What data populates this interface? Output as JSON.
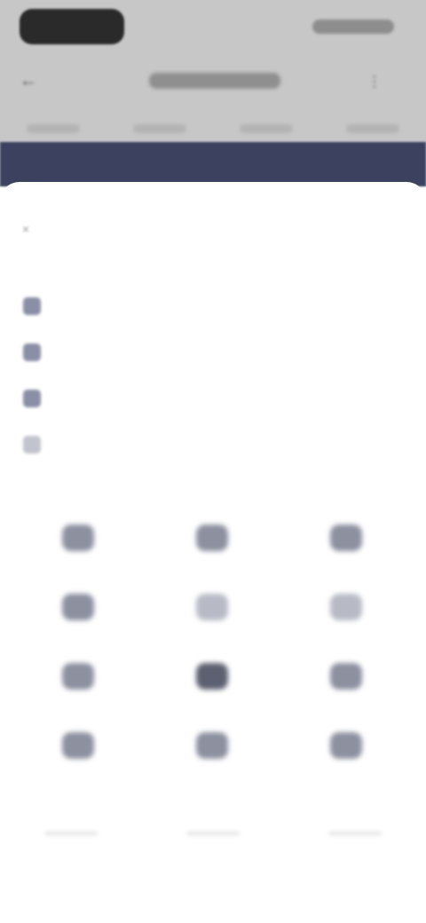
{
  "background": {
    "status_time": "",
    "status_right": "",
    "back_icon": "back-arrow-icon",
    "title": "",
    "action_icon": "more-icon",
    "tabs": [
      "",
      "",
      "",
      ""
    ],
    "nav_band_color": "#3c4160"
  },
  "sheet": {
    "close_icon": "×",
    "title": "",
    "section1_title": "",
    "menu": [
      {
        "label": "",
        "icon": "settings-icon"
      },
      {
        "label": "",
        "icon": "document-icon"
      },
      {
        "label": "",
        "icon": "list-icon"
      },
      {
        "label": "",
        "icon": "info-icon"
      }
    ],
    "section2_title": "",
    "grid": [
      {
        "label": "",
        "icon": "app-icon-1"
      },
      {
        "label": "",
        "icon": "app-icon-2"
      },
      {
        "label": "",
        "icon": "app-icon-3"
      },
      {
        "label": "",
        "icon": "app-icon-4"
      },
      {
        "label": "",
        "icon": "app-icon-5"
      },
      {
        "label": "",
        "icon": "app-icon-6"
      },
      {
        "label": "",
        "icon": "app-icon-7"
      },
      {
        "label": "",
        "icon": "app-icon-8"
      },
      {
        "label": "",
        "icon": "app-icon-9"
      },
      {
        "label": "",
        "icon": "app-icon-10"
      },
      {
        "label": "",
        "icon": "app-icon-11"
      },
      {
        "label": "",
        "icon": "app-icon-12"
      }
    ]
  },
  "colors": {
    "accent": "#3c4160",
    "scrim": "#c7c7c7",
    "sheet_bg": "#ffffff"
  }
}
